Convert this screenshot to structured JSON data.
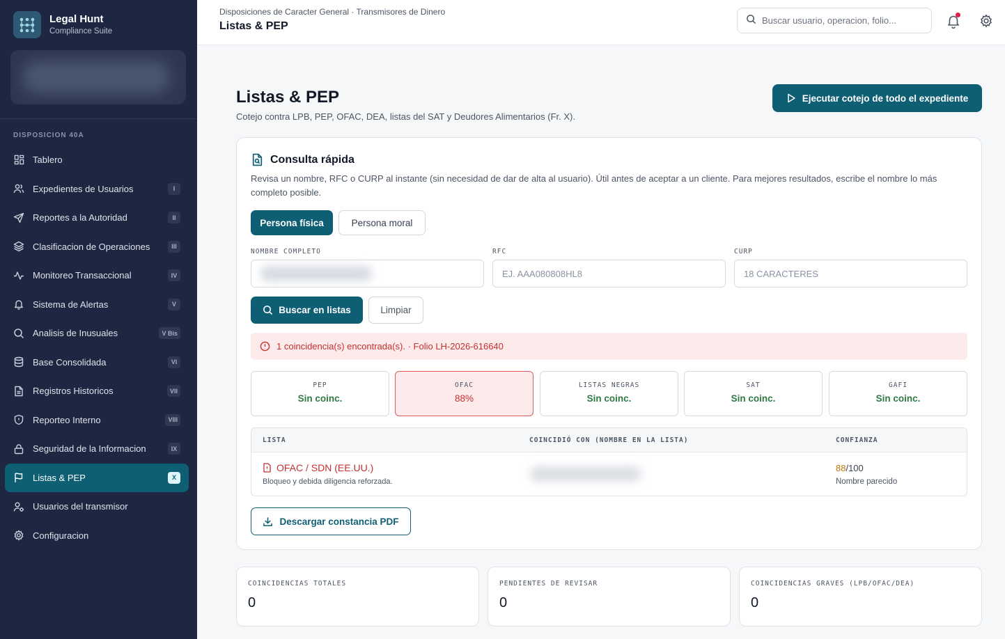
{
  "brand": {
    "name": "Legal Hunt",
    "subtitle": "Compliance Suite"
  },
  "sidebar": {
    "section": "DISPOSICION 40A",
    "items": [
      {
        "label": "Tablero",
        "badge": "",
        "icon": "dashboard-icon"
      },
      {
        "label": "Expedientes de Usuarios",
        "badge": "I",
        "icon": "users-icon"
      },
      {
        "label": "Reportes a la Autoridad",
        "badge": "II",
        "icon": "send-icon"
      },
      {
        "label": "Clasificacion de Operaciones",
        "badge": "III",
        "icon": "layers-icon"
      },
      {
        "label": "Monitoreo Transaccional",
        "badge": "IV",
        "icon": "activity-icon"
      },
      {
        "label": "Sistema de Alertas",
        "badge": "V",
        "icon": "bell-icon"
      },
      {
        "label": "Analisis de Inusuales",
        "badge": "V Bis",
        "icon": "search-icon"
      },
      {
        "label": "Base Consolidada",
        "badge": "VI",
        "icon": "database-icon"
      },
      {
        "label": "Registros Historicos",
        "badge": "VII",
        "icon": "file-text-icon"
      },
      {
        "label": "Reporteo Interno",
        "badge": "VIII",
        "icon": "shield-icon"
      },
      {
        "label": "Seguridad de la Informacion",
        "badge": "IX",
        "icon": "lock-icon"
      },
      {
        "label": "Listas & PEP",
        "badge": "X",
        "icon": "flag-icon"
      },
      {
        "label": "Usuarios del transmisor",
        "badge": "",
        "icon": "user-cog-icon"
      },
      {
        "label": "Configuracion",
        "badge": "",
        "icon": "gear-icon"
      }
    ]
  },
  "topbar": {
    "breadcrumb": "Disposiciones de Caracter General · Transmisores de Dinero",
    "title": "Listas & PEP",
    "search_placeholder": "Buscar usuario, operacion, folio..."
  },
  "page": {
    "title": "Listas & PEP",
    "description": "Cotejo contra LPB, PEP, OFAC, DEA, listas del SAT y Deudores Alimentarios (Fr. X).",
    "run_button": "Ejecutar cotejo de todo el expediente"
  },
  "quick": {
    "title": "Consulta rápida",
    "description": "Revisa un nombre, RFC o CURP al instante (sin necesidad de dar de alta al usuario). Útil antes de aceptar a un cliente. Para mejores resultados, escribe el nombre lo más completo posible.",
    "tab_fisica": "Persona física",
    "tab_moral": "Persona moral",
    "label_nombre": "NOMBRE COMPLETO",
    "label_rfc": "RFC",
    "label_curp": "CURP",
    "placeholder_rfc": "EJ. AAA080808HL8",
    "placeholder_curp": "18 CARACTERES",
    "search_button": "Buscar en listas",
    "clear_button": "Limpiar",
    "alert": "1 coincidencia(s) encontrada(s). · Folio LH-2026-616640",
    "tiles": [
      {
        "label": "PEP",
        "value": "Sin coinc."
      },
      {
        "label": "OFAC",
        "value": "88%"
      },
      {
        "label": "LISTAS NEGRAS",
        "value": "Sin coinc."
      },
      {
        "label": "SAT",
        "value": "Sin coinc."
      },
      {
        "label": "GAFI",
        "value": "Sin coinc."
      }
    ],
    "table": {
      "headers": [
        "LISTA",
        "COINCIDIÓ CON (NOMBRE EN LA LISTA)",
        "CONFIANZA"
      ],
      "row": {
        "list": "OFAC / SDN (EE.UU.)",
        "note": "Bloqueo y debida diligencia reforzada.",
        "score": "88",
        "score_max": "/100",
        "score_note": "Nombre parecido"
      }
    },
    "pdf_button": "Descargar constancia PDF"
  },
  "stats": [
    {
      "label": "COINCIDENCIAS TOTALES",
      "value": "0"
    },
    {
      "label": "PENDIENTES DE REVISAR",
      "value": "0"
    },
    {
      "label": "COINCIDENCIAS GRAVES (LPB/OFAC/DEA)",
      "value": "0"
    }
  ],
  "colors": {
    "sidebar": "#1e2742",
    "accent": "#0e5e74",
    "danger": "#c53030",
    "success": "#2f7a43",
    "warning": "#c27803"
  }
}
